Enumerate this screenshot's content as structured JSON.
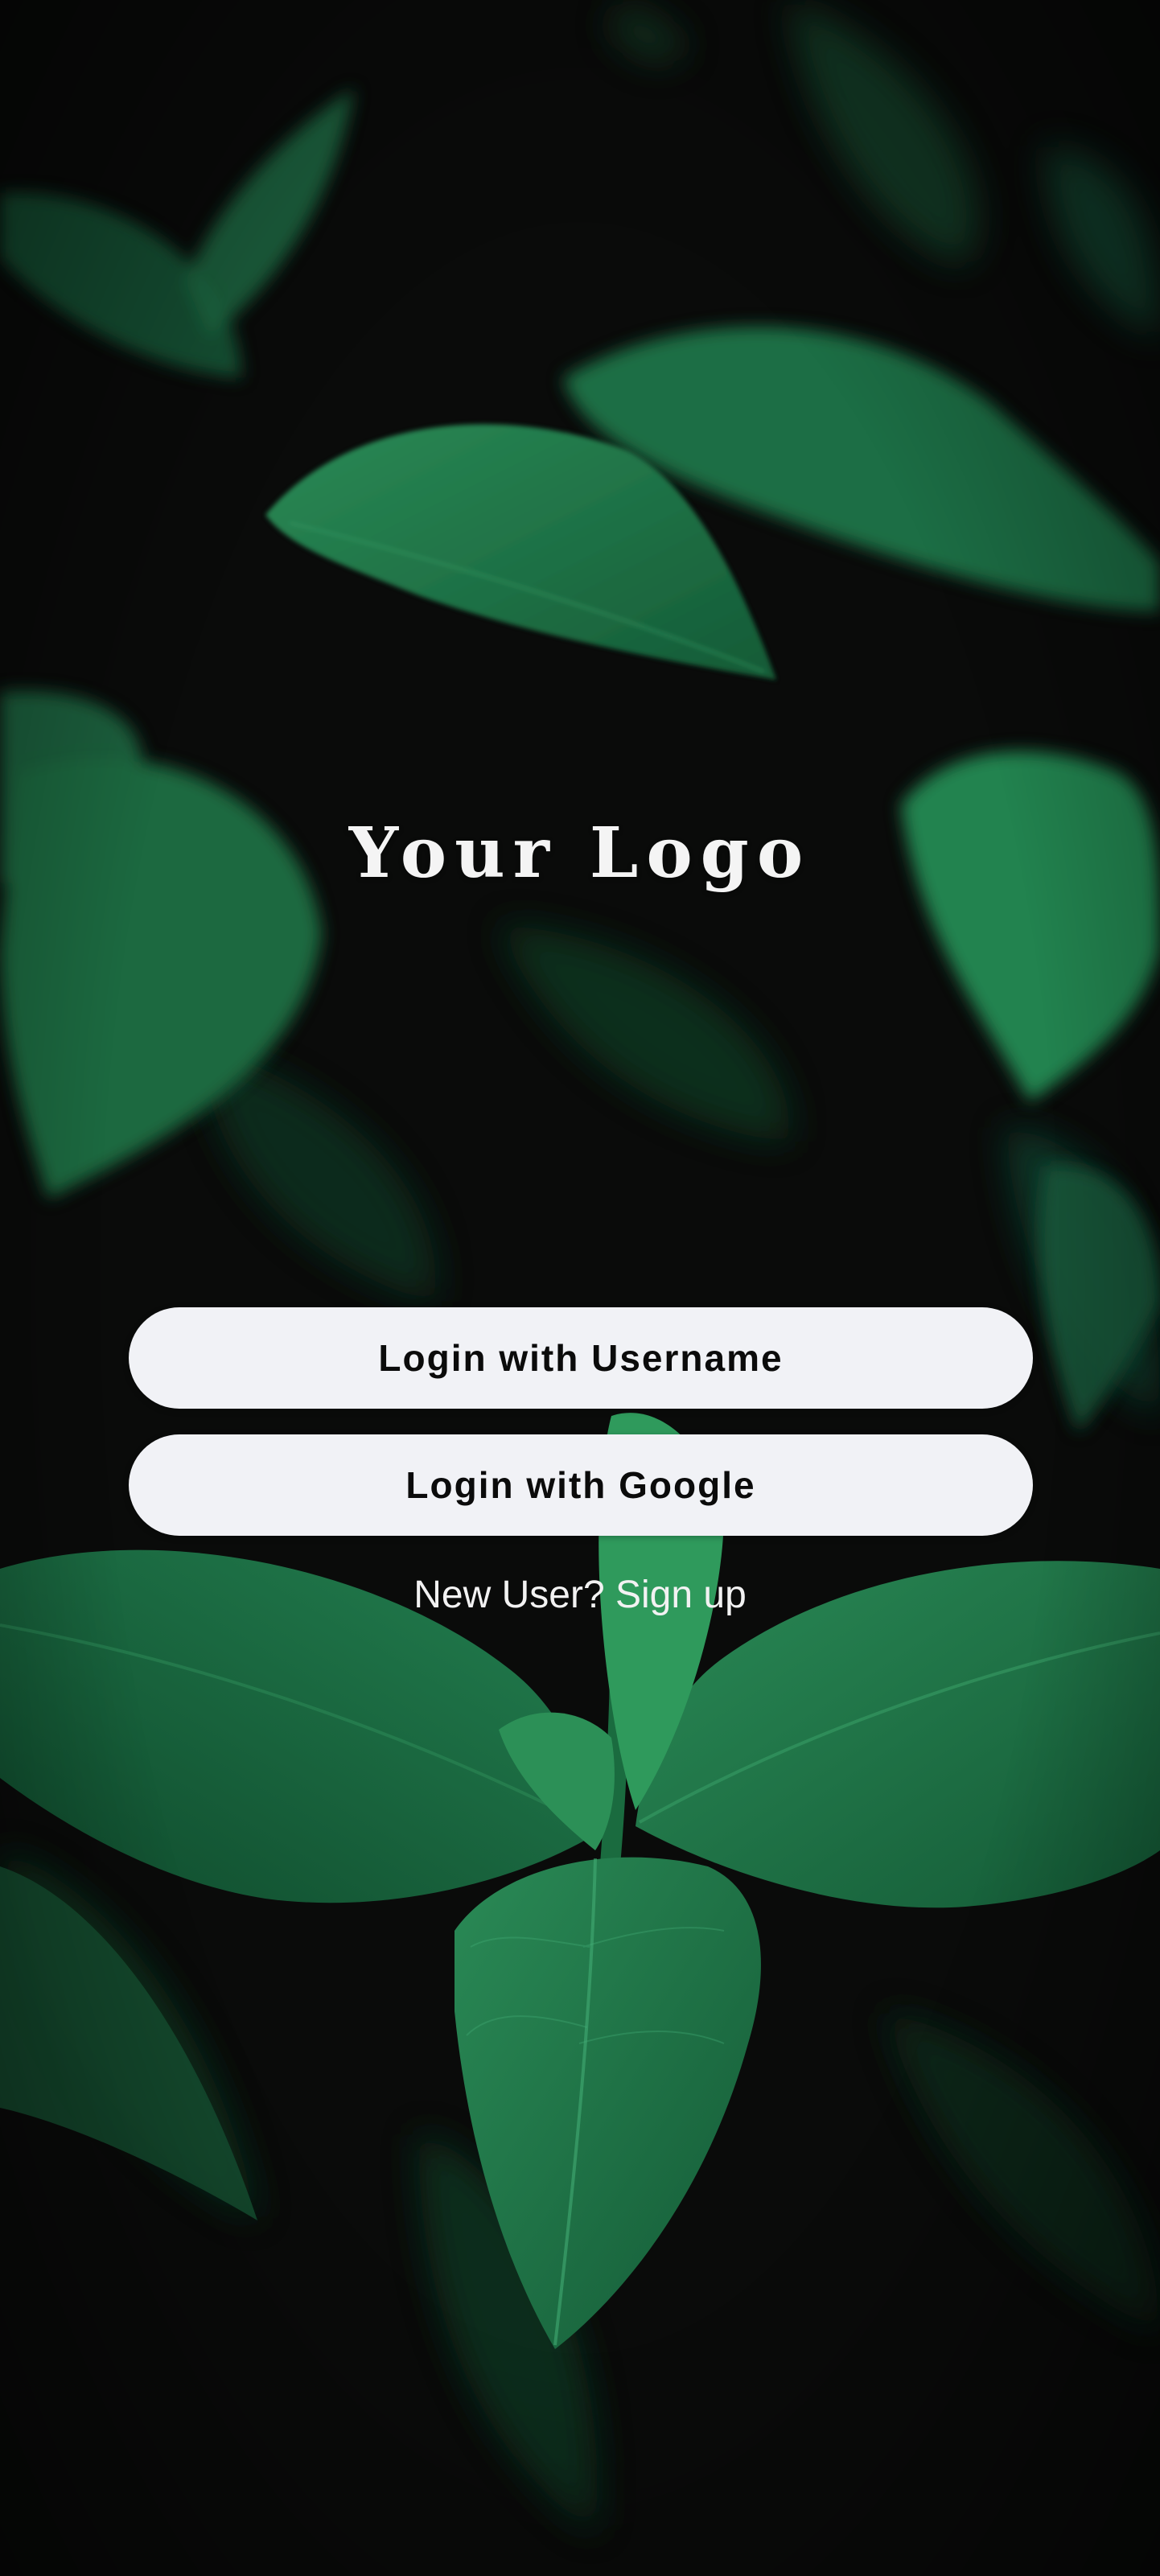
{
  "logo": {
    "text": "Your Logo"
  },
  "actions": {
    "login_username": "Login with Username",
    "login_google": "Login with Google",
    "signup_link": "New User? Sign up"
  },
  "colors": {
    "background": "#0a0b0a",
    "leaf_dark": "#0f3a24",
    "leaf_mid": "#1c6b43",
    "leaf_light": "#2a8a56",
    "button_bg": "#f1f2f6",
    "button_text": "#0b0b0b",
    "text_light": "#f4f4f4"
  }
}
